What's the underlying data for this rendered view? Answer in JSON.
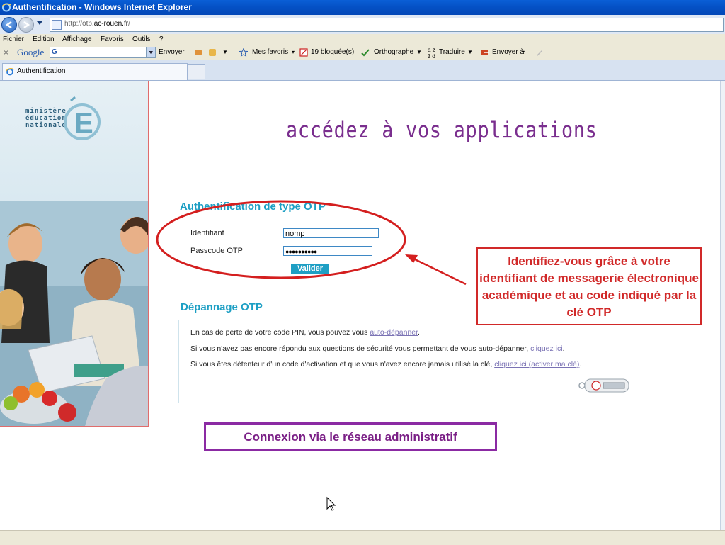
{
  "window": {
    "title": "Authentification - Windows Internet Explorer"
  },
  "address_bar": {
    "url_prefix": "http://otp.",
    "url_domain": "ac-rouen.fr",
    "url_suffix": "/"
  },
  "menu": [
    "Fichier",
    "Edition",
    "Affichage",
    "Favoris",
    "Outils",
    "?"
  ],
  "toolbar": {
    "google_brand": "Google",
    "google_g": "G",
    "envoyer": "Envoyer",
    "favoris": "Mes favoris",
    "bloquees": "19 bloquée(s)",
    "orthographe": "Orthographe",
    "traduire": "Traduire",
    "envoyer_a": "Envoyer à"
  },
  "tab": {
    "label": "Authentification"
  },
  "logo": {
    "line1": "ministère",
    "line2": "éducation",
    "line3": "nationale"
  },
  "page": {
    "heading": "accédez à vos applications",
    "auth": {
      "title": "Authentification de type OTP",
      "id_label": "Identifiant",
      "id_value": "nomp",
      "pass_label": "Passcode OTP",
      "pass_value": "●●●●●●●●●●",
      "submit": "Valider"
    },
    "depannage": {
      "title": "Dépannage OTP",
      "line1_text": "En cas de perte de votre code PIN, vous pouvez vous ",
      "line1_link": "auto-dépanner",
      "line1_end": ".",
      "line2_text": "Si vous n'avez pas encore répondu aux questions de sécurité vous permettant de vous auto-dépanner, ",
      "line2_link": "cliquez ici",
      "line2_end": ".",
      "line3_text": "Si vous êtes détenteur d'un code d'activation et que vous n'avez encore jamais utilisé la clé, ",
      "line3_link": "cliquez ici (activer ma clé)",
      "line3_end": "."
    }
  },
  "annotations": {
    "callout": "Identifiez-vous grâce à votre identifiant de messagerie électronique académique et au code indiqué par la clé OTP",
    "connexion": "Connexion via le réseau administratif"
  },
  "colors": {
    "heading": "#7a2e8e",
    "section_title": "#1d9fc4",
    "callout_red": "#d12929",
    "connexion_purple": "#8b2aa3"
  }
}
